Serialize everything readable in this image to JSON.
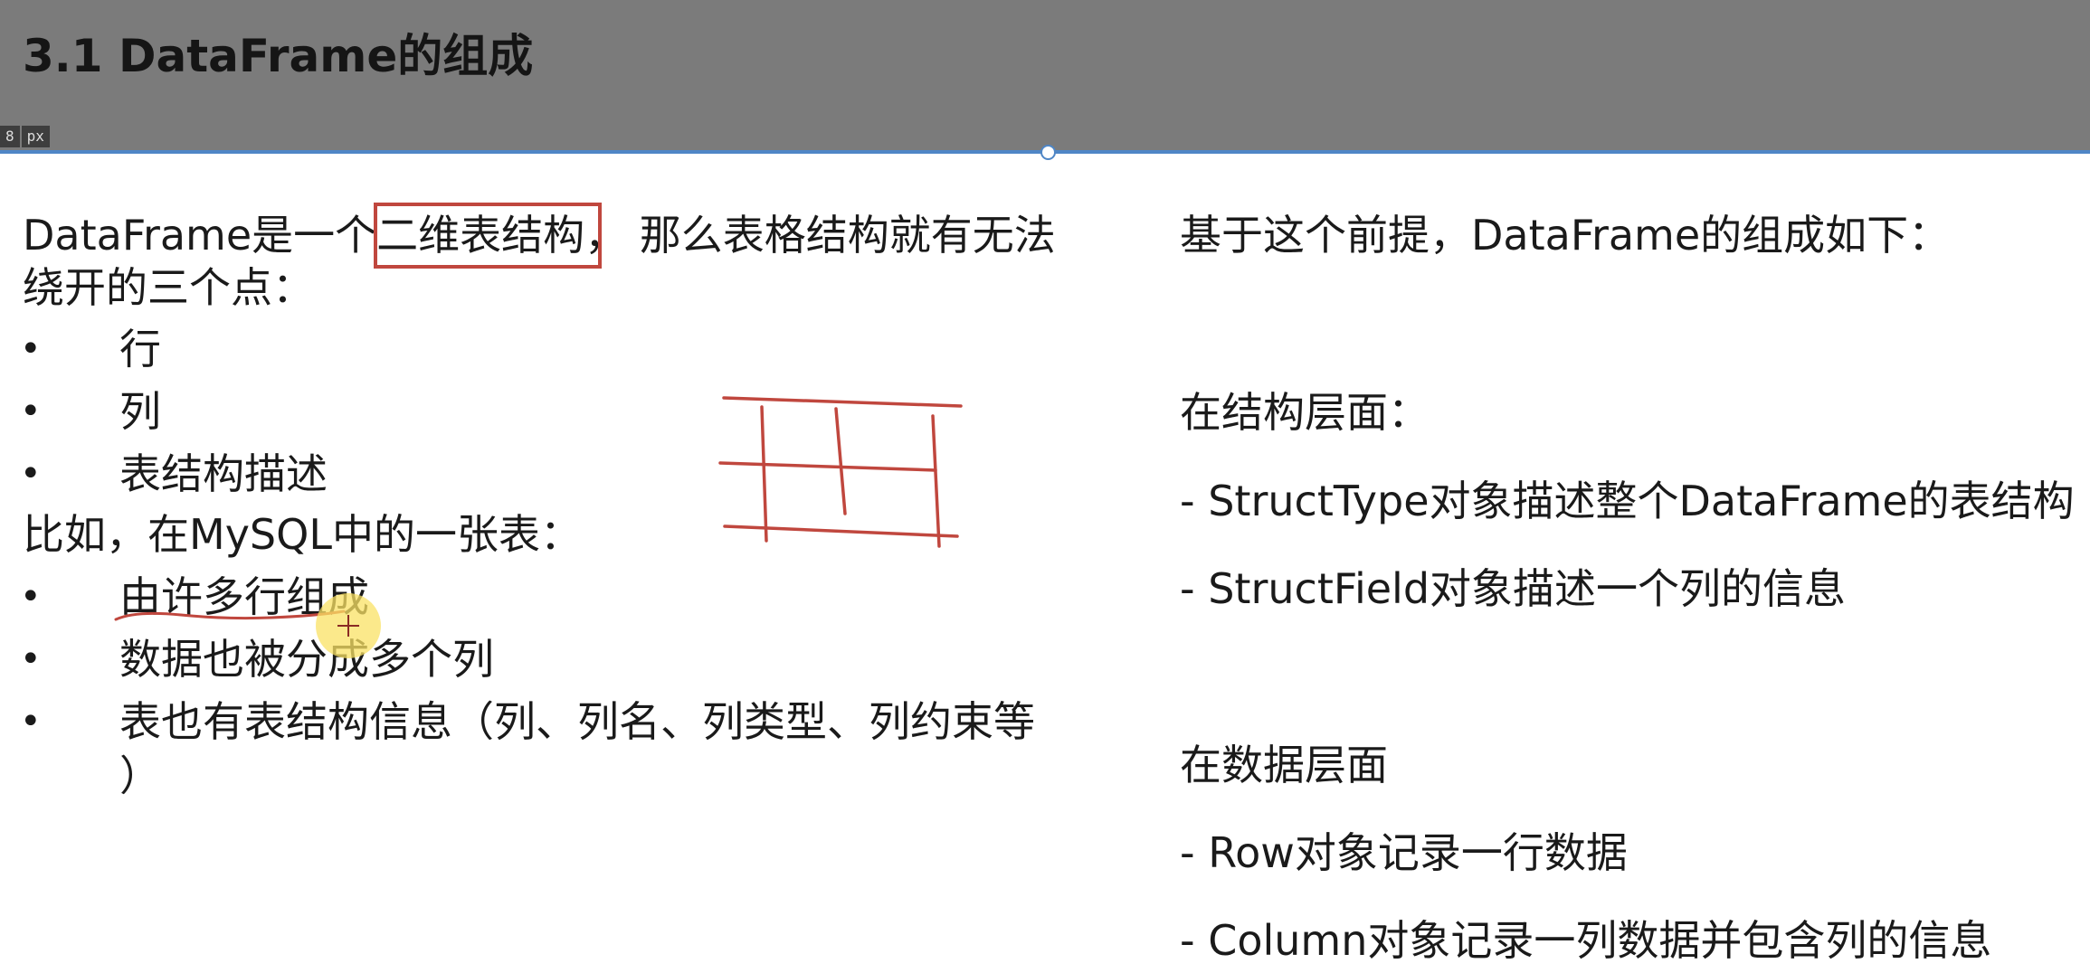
{
  "title": "3.1 DataFrame的组成",
  "ruler": {
    "value": "8",
    "unit": "px"
  },
  "left": {
    "intro_prefix": "DataFrame是一个",
    "intro_highlight": "二维表结构",
    "intro_suffix": "， 那么表格结构就有无法",
    "intro_line2": "绕开的三个点：",
    "points": [
      "行",
      "列",
      "表结构描述"
    ],
    "example_heading": "比如，在MySQL中的一张表：",
    "example_points": [
      "由许多行组成",
      "数据也被分成多个列",
      "表也有表结构信息（列、列名、列类型、列约束等"
    ],
    "example_point3_cont": "）",
    "bullet_char": "•"
  },
  "right": {
    "heading": "基于这个前提，DataFrame的组成如下：",
    "structure_heading": "在结构层面：",
    "structure_items": [
      "- StructType对象描述整个DataFrame的表结构",
      "- StructField对象描述一个列的信息"
    ],
    "data_heading": "在数据层面",
    "data_items": [
      "- Row对象记录一行数据",
      "- Column对象记录一列数据并包含列的信息"
    ]
  },
  "colors": {
    "header_bg": "#7b7b7b",
    "annotation_red": "#c0473e",
    "selection_blue": "#4f86c6",
    "cursor_highlight": "#fae264"
  }
}
